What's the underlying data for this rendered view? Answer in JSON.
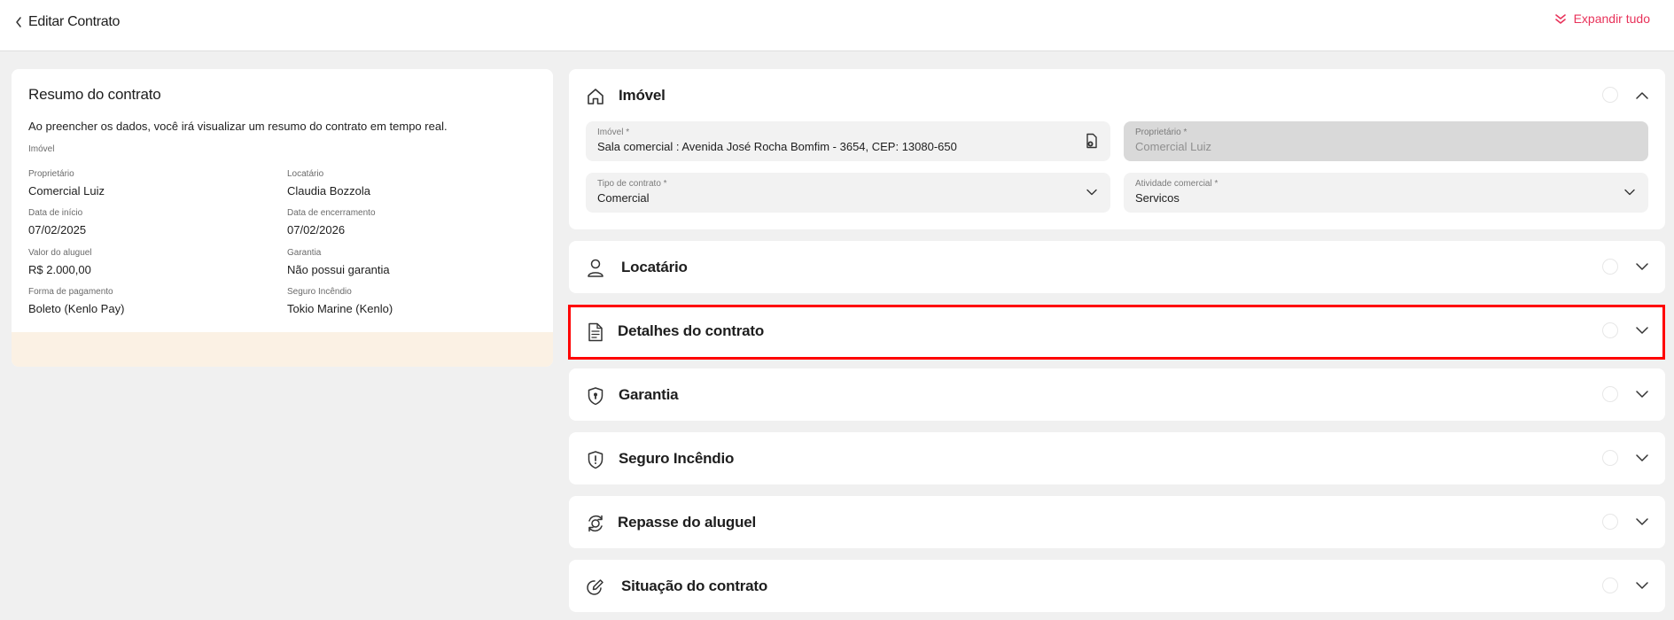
{
  "header": {
    "title": "Editar Contrato",
    "expand_all_label": "Expandir tudo",
    "accent_color": "#e8325a"
  },
  "summary": {
    "title": "Resumo do contrato",
    "description": "Ao preencher os dados, você irá visualizar um resumo do contrato em tempo real.",
    "section_label": "Imóvel",
    "fields": [
      {
        "label": "Proprietário",
        "value": "Comercial Luiz"
      },
      {
        "label": "Locatário",
        "value": "Claudia Bozzola"
      },
      {
        "label": "Data de início",
        "value": "07/02/2025"
      },
      {
        "label": "Data de encerramento",
        "value": "07/02/2026"
      },
      {
        "label": "Valor do aluguel",
        "value": "R$ 2.000,00"
      },
      {
        "label": "Garantia",
        "value": "Não possui garantia"
      },
      {
        "label": "Forma de pagamento",
        "value": "Boleto (Kenlo Pay)"
      },
      {
        "label": "Seguro Incêndio",
        "value": "Tokio Marine (Kenlo)"
      }
    ]
  },
  "panels": [
    {
      "title": "Imóvel",
      "icon": "home-icon",
      "expanded": true,
      "inputs": [
        {
          "label": "Imóvel *",
          "value": "Sala comercial : Avenida José Rocha Bomfim - 3654, CEP: 13080-650",
          "icon": "document-search-icon"
        },
        {
          "label": "Proprietário *",
          "value": "Comercial Luiz",
          "disabled": true
        },
        {
          "label": "Tipo de contrato *",
          "value": "Comercial",
          "icon": "chevron-down-icon"
        },
        {
          "label": "Atividade comercial *",
          "value": "Servicos",
          "icon": "chevron-down-icon"
        }
      ]
    },
    {
      "title": "Locatário",
      "icon": "person-icon",
      "expanded": false
    },
    {
      "title": "Detalhes do contrato",
      "icon": "file-text-icon",
      "expanded": false,
      "highlighted": true
    },
    {
      "title": "Garantia",
      "icon": "shield-lock-icon",
      "expanded": false
    },
    {
      "title": "Seguro Incêndio",
      "icon": "shield-alert-icon",
      "expanded": false
    },
    {
      "title": "Repasse do aluguel",
      "icon": "money-cycle-icon",
      "expanded": false
    },
    {
      "title": "Situação do contrato",
      "icon": "edit-circle-icon",
      "expanded": false
    }
  ]
}
